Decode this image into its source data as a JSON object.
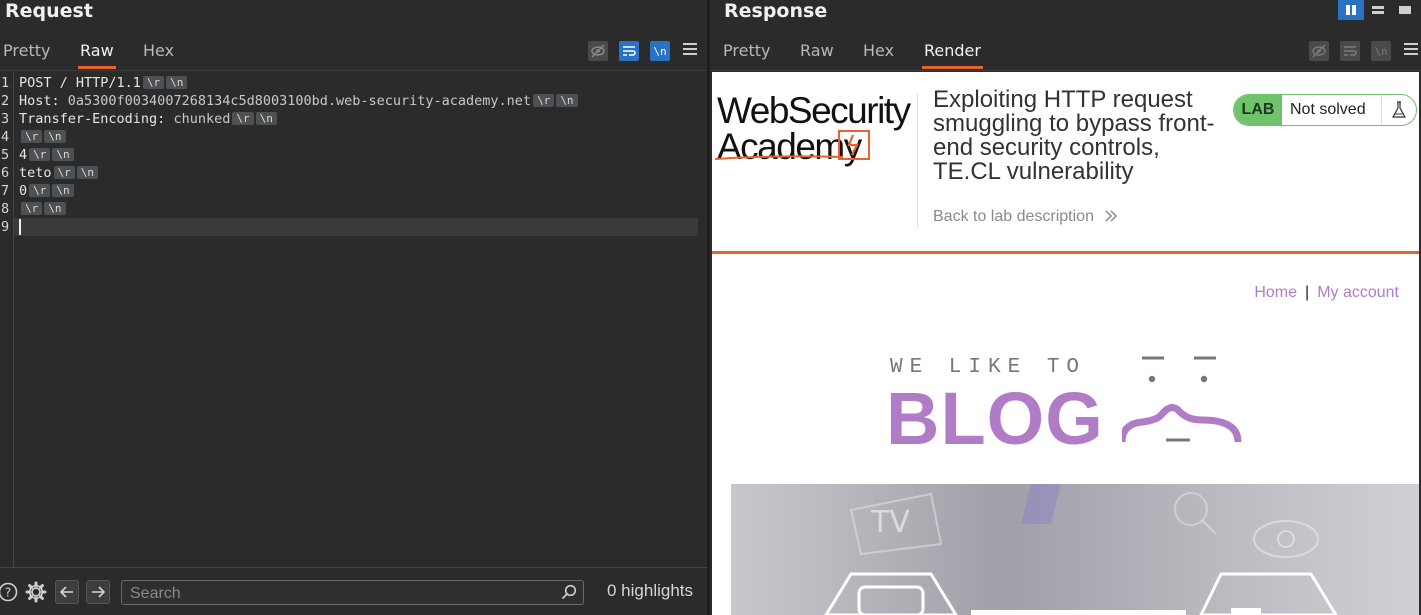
{
  "request": {
    "title": "Request",
    "tabs": [
      "Pretty",
      "Raw",
      "Hex"
    ],
    "active_tab": "Raw",
    "line_numbers": [
      "1",
      "2",
      "3",
      "4",
      "5",
      "6",
      "7",
      "8",
      "9"
    ],
    "lines": [
      {
        "text": "POST / HTTP/1.1",
        "crlf": true
      },
      {
        "name": "Host: ",
        "value": "0a5300f0034007268134c5d8003100bd.web-security-academy.net",
        "crlf": true
      },
      {
        "name": "Transfer-Encoding: ",
        "value": "chunked",
        "crlf": true
      },
      {
        "text": "",
        "crlf": true
      },
      {
        "text": "4",
        "crlf": true
      },
      {
        "text": "teto",
        "crlf": true
      },
      {
        "text": "0",
        "crlf": true
      },
      {
        "text": "",
        "crlf": true
      },
      {
        "text": "",
        "crlf": false
      }
    ],
    "cr_label": "\\r",
    "lf_label": "\\n",
    "newline_toggle_label": "\\n",
    "search_placeholder": "Search",
    "highlights": "0 highlights"
  },
  "response": {
    "title": "Response",
    "tabs": [
      "Pretty",
      "Raw",
      "Hex",
      "Render"
    ],
    "active_tab": "Render",
    "newline_toggle_label": "\\n",
    "render": {
      "logo_line1": "WebSecurity",
      "logo_line2": "Academy",
      "lab_title": "Exploiting HTTP request smuggling to bypass front-end security controls, TE.CL vulnerability",
      "back_link": "Back to lab description",
      "lab_badge": "LAB",
      "lab_status": "Not solved",
      "nav_home": "Home",
      "nav_sep": "|",
      "nav_account": "My account",
      "blog_tagline": "WE LIKE TO",
      "blog_word": "BLOG"
    }
  },
  "colors": {
    "accent_orange": "#e8622d",
    "toggle_blue": "#2a72c2",
    "lab_green": "#70c36b",
    "blog_purple": "#b07cc6"
  }
}
